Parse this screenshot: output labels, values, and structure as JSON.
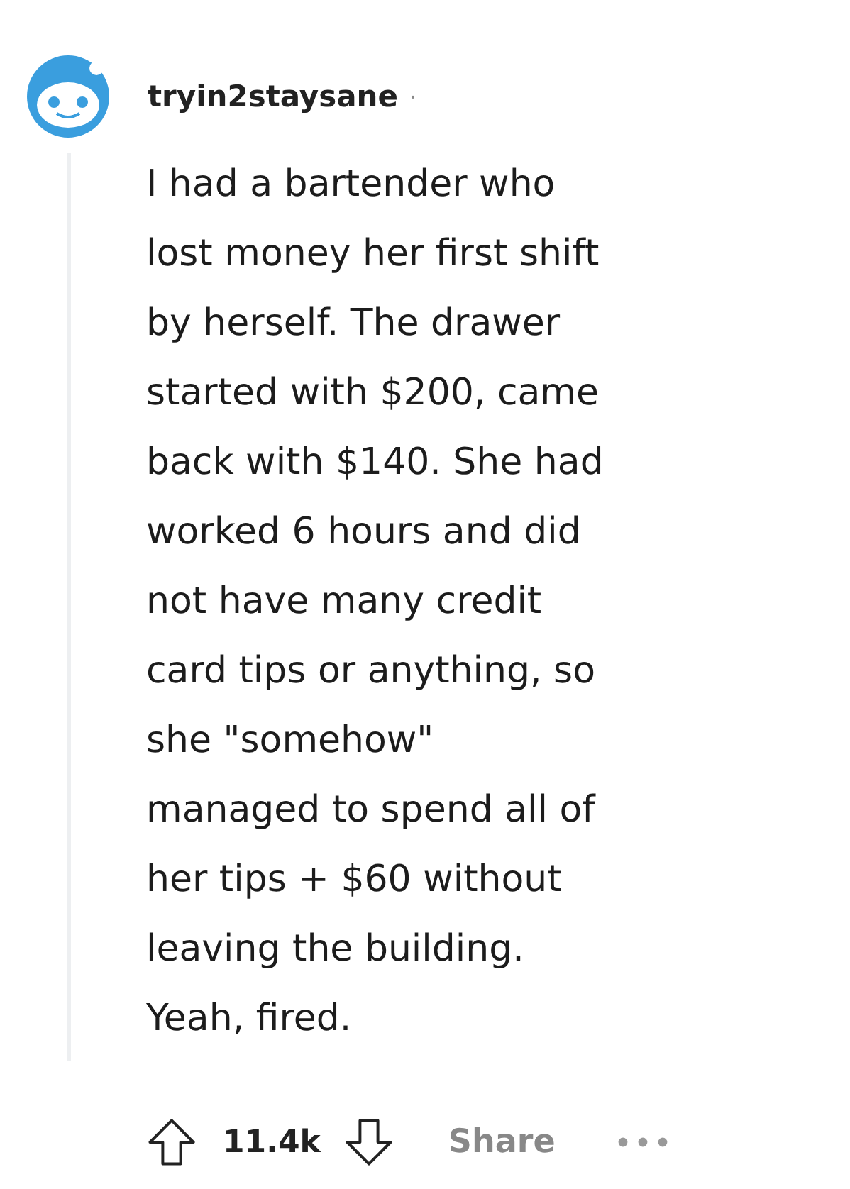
{
  "comment": {
    "author": "tryin2staysane",
    "separator": "·",
    "body": "I had a bartender who\nlost money her first shift\nby herself. The drawer\nstarted with $200, came\nback with $140. She had\nworked 6 hours and did\nnot have many credit\ncard tips or anything, so\nshe \"somehow\"\nmanaged to spend all of\nher tips + $60 without\nleaving the building.\nYeah, fired.",
    "score": "11.4k",
    "share": "Share"
  }
}
